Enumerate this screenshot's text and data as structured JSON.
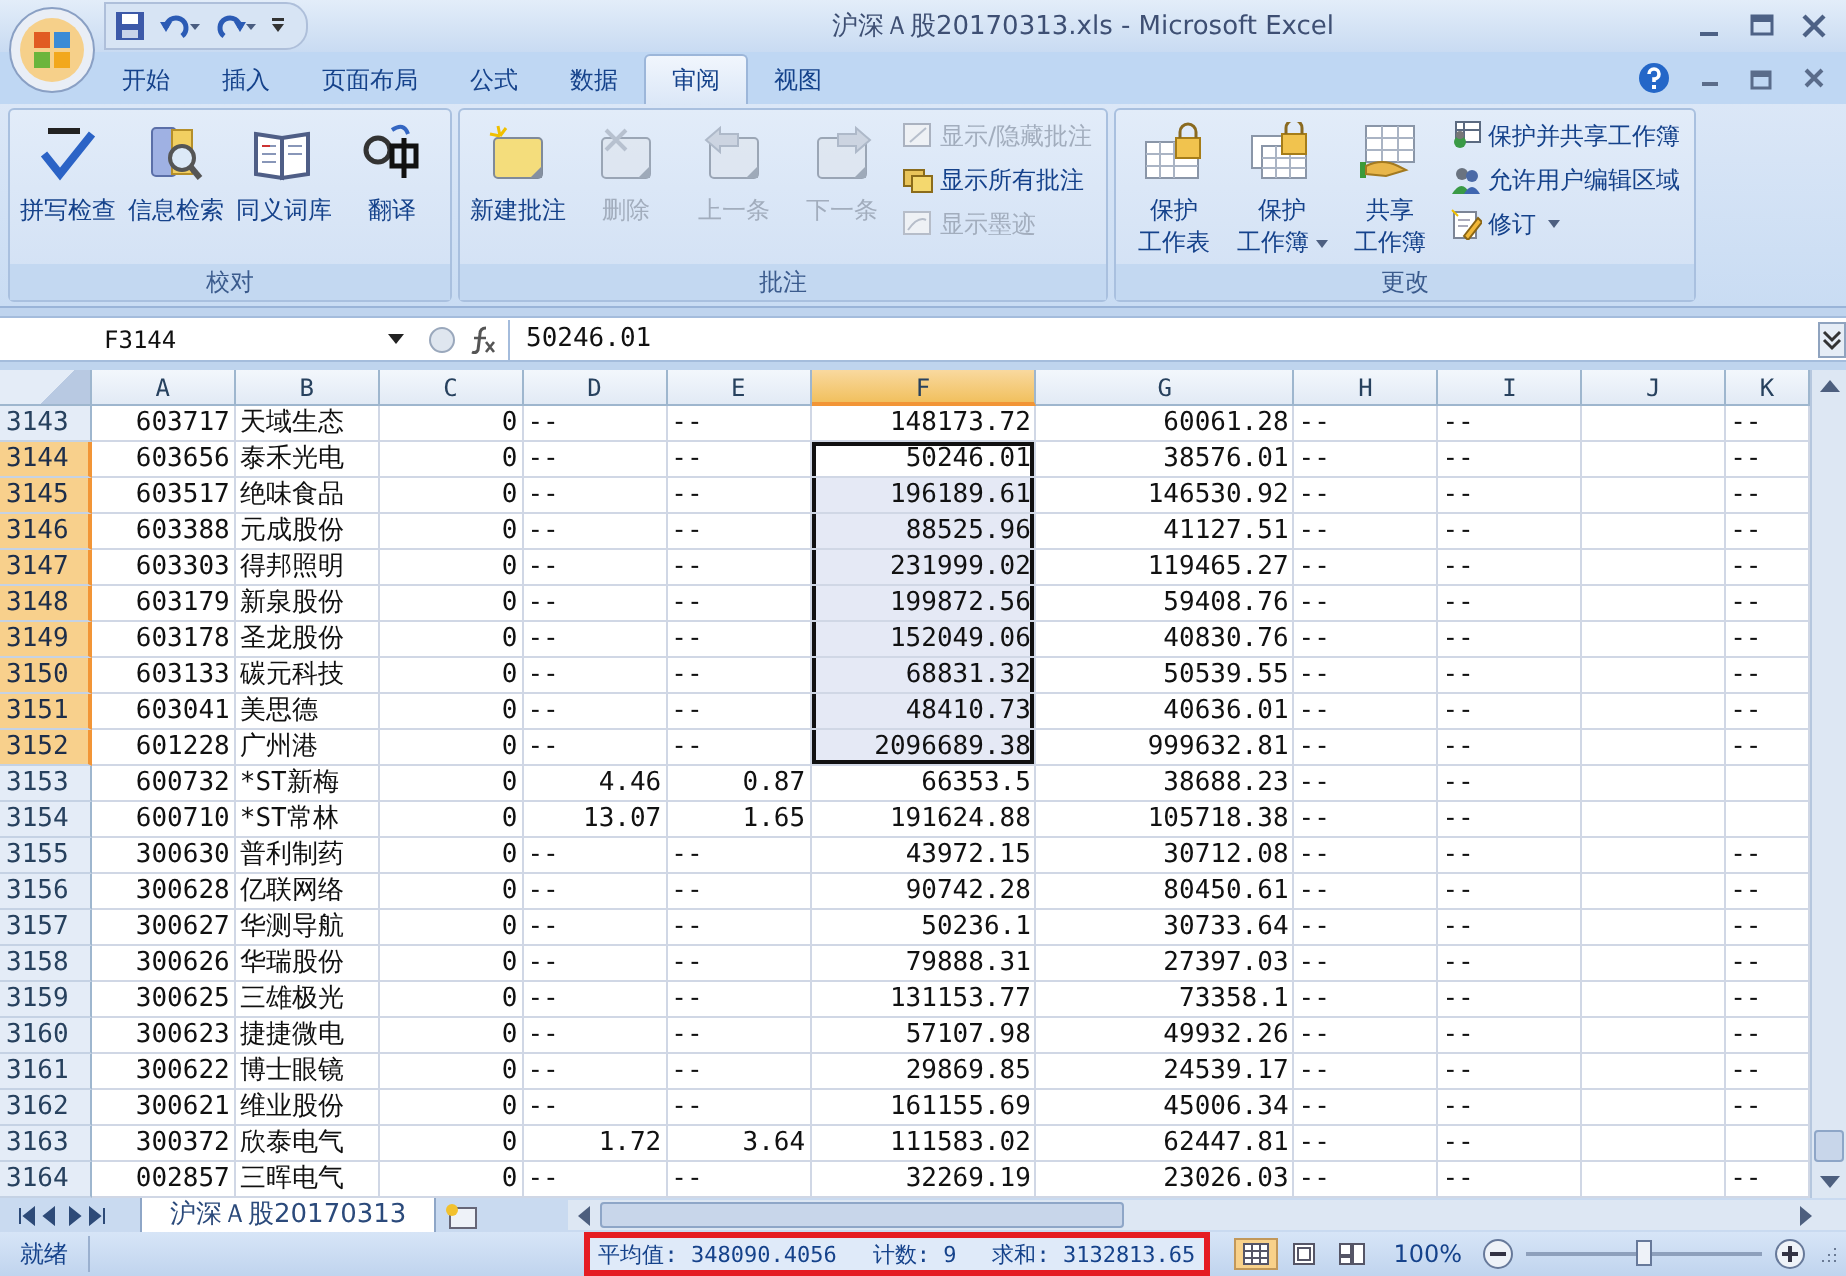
{
  "window": {
    "title": "沪深Ａ股20170313.xls - Microsoft Excel"
  },
  "tabs": [
    {
      "label": "开始",
      "selected": false
    },
    {
      "label": "插入",
      "selected": false
    },
    {
      "label": "页面布局",
      "selected": false
    },
    {
      "label": "公式",
      "selected": false
    },
    {
      "label": "数据",
      "selected": false
    },
    {
      "label": "审阅",
      "selected": true
    },
    {
      "label": "视图",
      "selected": false
    }
  ],
  "ribbon": {
    "groups": [
      {
        "title": "校对",
        "buttons": [
          {
            "lines": [
              "拼写检查"
            ],
            "disabled": false,
            "dropdown": false
          },
          {
            "lines": [
              "信息检索"
            ],
            "disabled": false,
            "dropdown": false
          },
          {
            "lines": [
              "同义词库"
            ],
            "disabled": false,
            "dropdown": false
          },
          {
            "lines": [
              "翻译"
            ],
            "disabled": false,
            "dropdown": false
          }
        ]
      },
      {
        "title": "批注",
        "buttons": [
          {
            "lines": [
              "新建批注"
            ],
            "disabled": false,
            "dropdown": false
          },
          {
            "lines": [
              "删除"
            ],
            "disabled": true,
            "dropdown": false
          },
          {
            "lines": [
              "上一条"
            ],
            "disabled": true,
            "dropdown": false
          },
          {
            "lines": [
              "下一条"
            ],
            "disabled": true,
            "dropdown": false
          }
        ],
        "small_buttons": [
          {
            "label": "显示/隐藏批注",
            "disabled": true,
            "dropdown": false
          },
          {
            "label": "显示所有批注",
            "disabled": false,
            "dropdown": false
          },
          {
            "label": "显示墨迹",
            "disabled": true,
            "dropdown": false
          }
        ]
      },
      {
        "title": "更改",
        "buttons": [
          {
            "lines": [
              "保护",
              "工作表"
            ],
            "disabled": false,
            "dropdown": false
          },
          {
            "lines": [
              "保护",
              "工作簿"
            ],
            "disabled": false,
            "dropdown": true
          },
          {
            "lines": [
              "共享",
              "工作簿"
            ],
            "disabled": false,
            "dropdown": false
          }
        ],
        "small_buttons": [
          {
            "label": "保护并共享工作簿",
            "disabled": false,
            "dropdown": false
          },
          {
            "label": "允许用户编辑区域",
            "disabled": false,
            "dropdown": false
          },
          {
            "label": "修订",
            "disabled": false,
            "dropdown": true
          }
        ]
      }
    ]
  },
  "formula_bar": {
    "name_box": "F3144",
    "formula": "50246.01"
  },
  "columns": [
    {
      "label": "A",
      "selected": false
    },
    {
      "label": "B",
      "selected": false
    },
    {
      "label": "C",
      "selected": false
    },
    {
      "label": "D",
      "selected": false
    },
    {
      "label": "E",
      "selected": false
    },
    {
      "label": "F",
      "selected": true
    },
    {
      "label": "G",
      "selected": false
    },
    {
      "label": "H",
      "selected": false
    },
    {
      "label": "I",
      "selected": false
    },
    {
      "label": "J",
      "selected": false
    },
    {
      "label": "K",
      "selected": false
    }
  ],
  "rows": [
    {
      "num": "3143",
      "selected": false,
      "cells": [
        "603717",
        "天域生态",
        "0",
        "--",
        "--",
        "148173.72",
        "60061.28",
        "--",
        "--",
        null,
        "--"
      ]
    },
    {
      "num": "3144",
      "selected": true,
      "cells": [
        "603656",
        "泰禾光电",
        "0",
        "--",
        "--",
        "50246.01",
        "38576.01",
        "--",
        "--",
        null,
        "--"
      ]
    },
    {
      "num": "3145",
      "selected": true,
      "cells": [
        "603517",
        "绝味食品",
        "0",
        "--",
        "--",
        "196189.61",
        "146530.92",
        "--",
        "--",
        null,
        "--"
      ]
    },
    {
      "num": "3146",
      "selected": true,
      "cells": [
        "603388",
        "元成股份",
        "0",
        "--",
        "--",
        "88525.96",
        "41127.51",
        "--",
        "--",
        null,
        "--"
      ]
    },
    {
      "num": "3147",
      "selected": true,
      "cells": [
        "603303",
        "得邦照明",
        "0",
        "--",
        "--",
        "231999.02",
        "119465.27",
        "--",
        "--",
        null,
        "--"
      ]
    },
    {
      "num": "3148",
      "selected": true,
      "cells": [
        "603179",
        "新泉股份",
        "0",
        "--",
        "--",
        "199872.56",
        "59408.76",
        "--",
        "--",
        null,
        "--"
      ]
    },
    {
      "num": "3149",
      "selected": true,
      "cells": [
        "603178",
        "圣龙股份",
        "0",
        "--",
        "--",
        "152049.06",
        "40830.76",
        "--",
        "--",
        null,
        "--"
      ]
    },
    {
      "num": "3150",
      "selected": true,
      "cells": [
        "603133",
        "碳元科技",
        "0",
        "--",
        "--",
        "68831.32",
        "50539.55",
        "--",
        "--",
        null,
        "--"
      ]
    },
    {
      "num": "3151",
      "selected": true,
      "cells": [
        "603041",
        "美思德",
        "0",
        "--",
        "--",
        "48410.73",
        "40636.01",
        "--",
        "--",
        null,
        "--"
      ]
    },
    {
      "num": "3152",
      "selected": true,
      "cells": [
        "601228",
        "广州港",
        "0",
        "--",
        "--",
        "2096689.38",
        "999632.81",
        "--",
        "--",
        null,
        "--"
      ]
    },
    {
      "num": "3153",
      "selected": false,
      "cells": [
        "600732",
        "*ST新梅",
        "0",
        "4.46",
        "0.87",
        "66353.5",
        "38688.23",
        "--",
        "--",
        null,
        null
      ]
    },
    {
      "num": "3154",
      "selected": false,
      "cells": [
        "600710",
        "*ST常林",
        "0",
        "13.07",
        "1.65",
        "191624.88",
        "105718.38",
        "--",
        "--",
        null,
        null
      ]
    },
    {
      "num": "3155",
      "selected": false,
      "cells": [
        "300630",
        "普利制药",
        "0",
        "--",
        "--",
        "43972.15",
        "30712.08",
        "--",
        "--",
        null,
        "--"
      ]
    },
    {
      "num": "3156",
      "selected": false,
      "cells": [
        "300628",
        "亿联网络",
        "0",
        "--",
        "--",
        "90742.28",
        "80450.61",
        "--",
        "--",
        null,
        "--"
      ]
    },
    {
      "num": "3157",
      "selected": false,
      "cells": [
        "300627",
        "华测导航",
        "0",
        "--",
        "--",
        "50236.1",
        "30733.64",
        "--",
        "--",
        null,
        "--"
      ]
    },
    {
      "num": "3158",
      "selected": false,
      "cells": [
        "300626",
        "华瑞股份",
        "0",
        "--",
        "--",
        "79888.31",
        "27397.03",
        "--",
        "--",
        null,
        "--"
      ]
    },
    {
      "num": "3159",
      "selected": false,
      "cells": [
        "300625",
        "三雄极光",
        "0",
        "--",
        "--",
        "131153.77",
        "73358.1",
        "--",
        "--",
        null,
        "--"
      ]
    },
    {
      "num": "3160",
      "selected": false,
      "cells": [
        "300623",
        "捷捷微电",
        "0",
        "--",
        "--",
        "57107.98",
        "49932.26",
        "--",
        "--",
        null,
        "--"
      ]
    },
    {
      "num": "3161",
      "selected": false,
      "cells": [
        "300622",
        "博士眼镜",
        "0",
        "--",
        "--",
        "29869.85",
        "24539.17",
        "--",
        "--",
        null,
        "--"
      ]
    },
    {
      "num": "3162",
      "selected": false,
      "cells": [
        "300621",
        "维业股份",
        "0",
        "--",
        "--",
        "161155.69",
        "45006.34",
        "--",
        "--",
        null,
        "--"
      ]
    },
    {
      "num": "3163",
      "selected": false,
      "cells": [
        "300372",
        "欣泰电气",
        "0",
        "1.72",
        "3.64",
        "111583.02",
        "62447.81",
        "--",
        "--",
        null,
        null
      ]
    },
    {
      "num": "3164",
      "selected": false,
      "cells": [
        "002857",
        "三晖电气",
        "0",
        "--",
        "--",
        "32269.19",
        "23026.03",
        "--",
        "--",
        null,
        "--"
      ]
    }
  ],
  "sheet_tabs": [
    {
      "label": "沪深Ａ股20170313",
      "selected": true
    }
  ],
  "status_bar": {
    "ready": "就绪",
    "summary": [
      "平均值: 348090.4056",
      "计数: 9",
      "求和: 3132813.65"
    ],
    "views": [
      {
        "selected": true
      },
      {
        "selected": false
      },
      {
        "selected": false
      }
    ],
    "zoom": "100%",
    "zoom_slider": {
      "level": 0.5
    }
  }
}
